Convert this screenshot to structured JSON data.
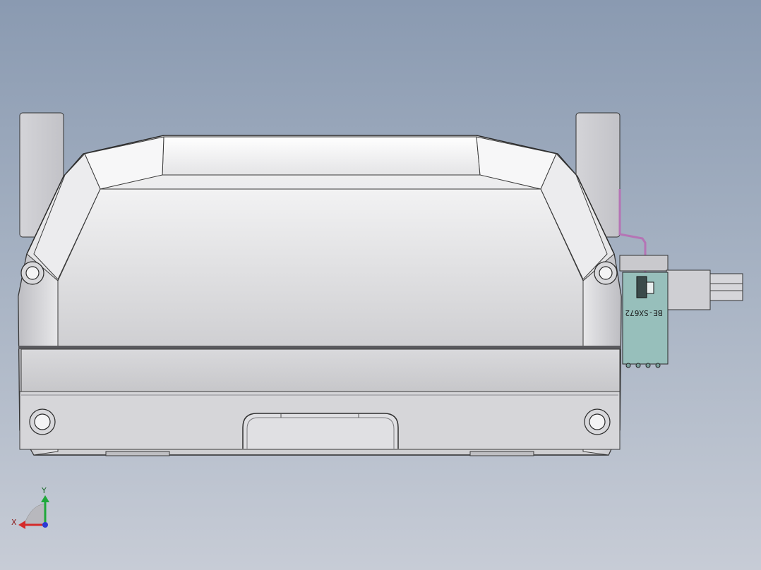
{
  "viewport": {
    "background_top": "#8a9ab1",
    "background_bottom": "#c7ccd6"
  },
  "model": {
    "body_color": "#e6e6e8",
    "edge_color": "#2a2a2a",
    "connector_color": "#97bfbb",
    "wire_color": "#b574b5",
    "connector_label": "BE-SX672"
  },
  "triad": {
    "x_label": "X",
    "y_label": "Y",
    "x_color": "#d42a2a",
    "y_color": "#1fa83a",
    "z_color": "#2a3ad4"
  }
}
